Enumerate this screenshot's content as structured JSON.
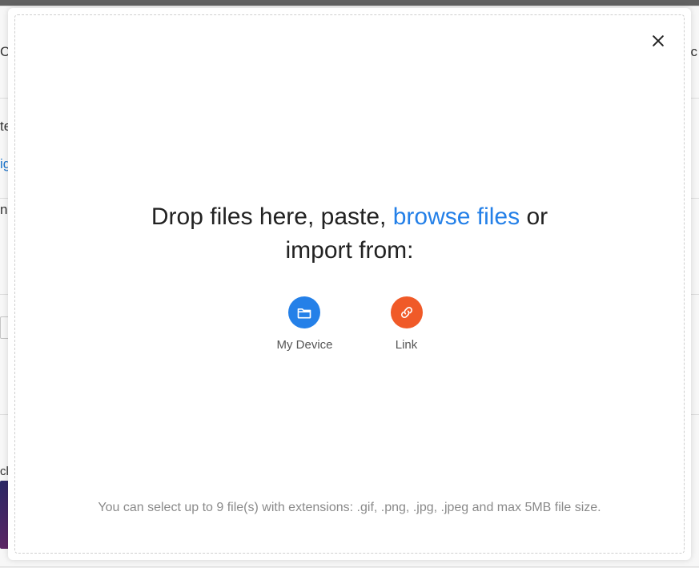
{
  "background": {
    "frag_ca": "Ca",
    "frag_te": "te",
    "frag_igi": "igi",
    "frag_nw": "n w",
    "frag_cli": "cli",
    "frag_tic": "tic"
  },
  "modal": {
    "drop_prefix": "Drop files here, paste, ",
    "browse_label": "browse files",
    "drop_middle": " or",
    "drop_suffix": "import from:",
    "sources": {
      "device": {
        "label": "My Device"
      },
      "link": {
        "label": "Link"
      }
    },
    "footer": "You can select up to 9 file(s) with extensions: .gif, .png, .jpg, .jpeg and max 5MB file size."
  }
}
